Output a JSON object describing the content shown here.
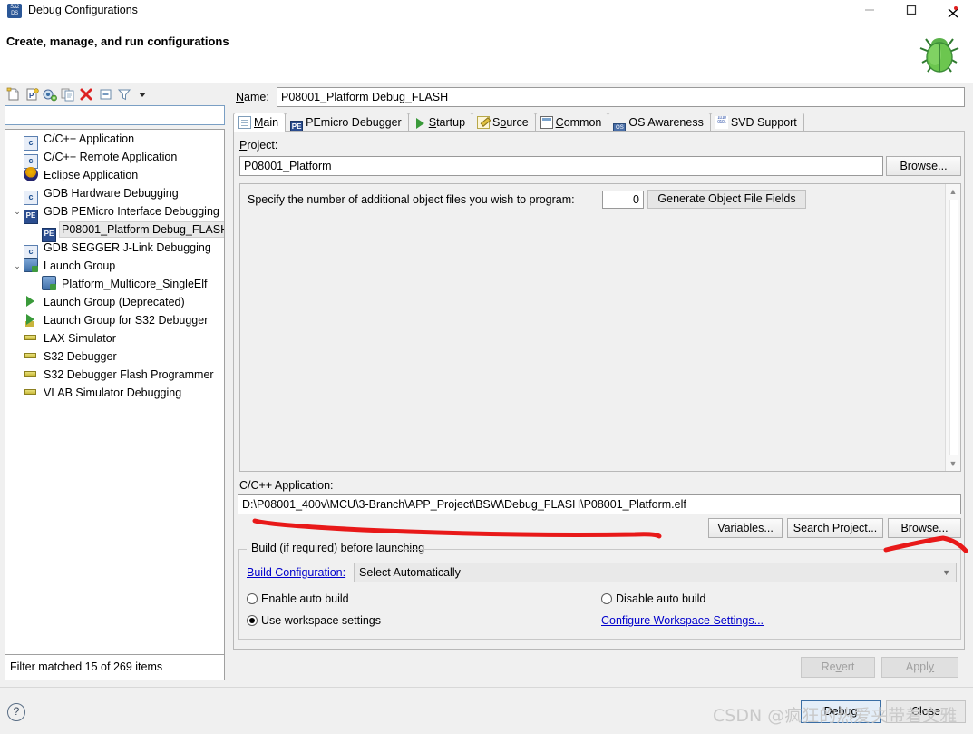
{
  "window": {
    "title": "Debug Configurations",
    "icon": "s32ds-icon",
    "minimize": "–",
    "maximize": "□",
    "close": "✕"
  },
  "header": {
    "title": "Create, manage, and run configurations",
    "decor_icon": "green-bug-icon"
  },
  "left_panel": {
    "toolbar_icons": [
      "new-config-icon",
      "new-prototype-icon",
      "export-icon",
      "duplicate-icon",
      "delete-icon",
      "collapse-all-icon",
      "filter-icon",
      "view-menu-icon"
    ],
    "filter_value": "",
    "filter_placeholder": "",
    "tree": [
      {
        "label": "C/C++ Application",
        "icon": "c-file-icon",
        "indent": 1,
        "twisty": "",
        "selected": false
      },
      {
        "label": "C/C++ Remote Application",
        "icon": "c-file-icon",
        "indent": 1,
        "twisty": "",
        "selected": false
      },
      {
        "label": "Eclipse Application",
        "icon": "eclipse-icon",
        "indent": 1,
        "twisty": "",
        "selected": false
      },
      {
        "label": "GDB Hardware Debugging",
        "icon": "c-file-icon",
        "indent": 1,
        "twisty": "",
        "selected": false
      },
      {
        "label": "GDB PEMicro Interface Debugging",
        "icon": "pemicro-icon",
        "indent": 1,
        "twisty": "⌄",
        "selected": false
      },
      {
        "label": "P08001_Platform Debug_FLASH",
        "icon": "pemicro-icon",
        "indent": 2,
        "twisty": "",
        "selected": true
      },
      {
        "label": "GDB SEGGER J-Link Debugging",
        "icon": "c-file-icon",
        "indent": 1,
        "twisty": "",
        "selected": false
      },
      {
        "label": "Launch Group",
        "icon": "launch-group-icon",
        "indent": 1,
        "twisty": "⌄",
        "selected": false
      },
      {
        "label": "Platform_Multicore_SingleElf",
        "icon": "launch-group-icon",
        "indent": 2,
        "twisty": "",
        "selected": false
      },
      {
        "label": "Launch Group (Deprecated)",
        "icon": "play-icon",
        "indent": 1,
        "twisty": "",
        "selected": false
      },
      {
        "label": "Launch Group for S32 Debugger",
        "icon": "play-stacked-icon",
        "indent": 1,
        "twisty": "",
        "selected": false
      },
      {
        "label": "LAX Simulator",
        "icon": "chip-icon",
        "indent": 1,
        "twisty": "",
        "selected": false
      },
      {
        "label": "S32 Debugger",
        "icon": "chip-icon",
        "indent": 1,
        "twisty": "",
        "selected": false
      },
      {
        "label": "S32 Debugger Flash Programmer",
        "icon": "chip-icon",
        "indent": 1,
        "twisty": "",
        "selected": false
      },
      {
        "label": "VLAB Simulator Debugging",
        "icon": "chip-icon",
        "indent": 1,
        "twisty": "",
        "selected": false
      }
    ],
    "filter_status": "Filter matched 15 of 269 items"
  },
  "right_panel": {
    "name_label": "Name:",
    "name_value": "P08001_Platform Debug_FLASH",
    "tabs": [
      {
        "label": "Main",
        "icon": "document-icon",
        "active": true
      },
      {
        "label": "PEmicro Debugger",
        "icon": "pemicro-icon",
        "active": false
      },
      {
        "label": "Startup",
        "icon": "play-icon",
        "active": false
      },
      {
        "label": "Source",
        "icon": "source-icon",
        "active": false
      },
      {
        "label": "Common",
        "icon": "common-icon",
        "active": false
      },
      {
        "label": "OS Awareness",
        "icon": "os-awareness-icon",
        "active": false
      },
      {
        "label": "SVD Support",
        "icon": "svd-icon",
        "active": false
      }
    ],
    "main_tab": {
      "project_label": "Project:",
      "project_value": "P08001_Platform",
      "project_browse": "Browse...",
      "objfiles_text": "Specify the number of additional object files you wish to program:",
      "objfiles_count": "0",
      "generate_button": "Generate Object File Fields",
      "cpp_label": "C/C++ Application:",
      "cpp_value": "D:\\P08001_400v\\MCU\\3-Branch\\APP_Project\\BSW\\Debug_FLASH\\P08001_Platform.elf",
      "variables_button": "Variables...",
      "search_project_button": "Search Project...",
      "browse_button": "Browse...",
      "build_group_label": "Build (if required) before launching",
      "build_config_link": "Build Configuration:",
      "build_config_value": "Select Automatically",
      "radio_enable_auto": "Enable auto build",
      "radio_disable_auto": "Disable auto build",
      "radio_use_workspace": "Use workspace settings",
      "configure_workspace_link": "Configure Workspace Settings...",
      "selected_radio": "use_workspace"
    },
    "revert_button": "Revert",
    "apply_button": "Apply"
  },
  "footer": {
    "help_icon": "?",
    "debug_button": "Debug",
    "close_button": "Close"
  },
  "overlay": {
    "watermark": "CSDN @疯狂的热爱夹带着文雅",
    "annotation_color": "#e81919",
    "annotations": [
      "underline-under-cpp-application-field",
      "arc-under-browse-button"
    ]
  }
}
